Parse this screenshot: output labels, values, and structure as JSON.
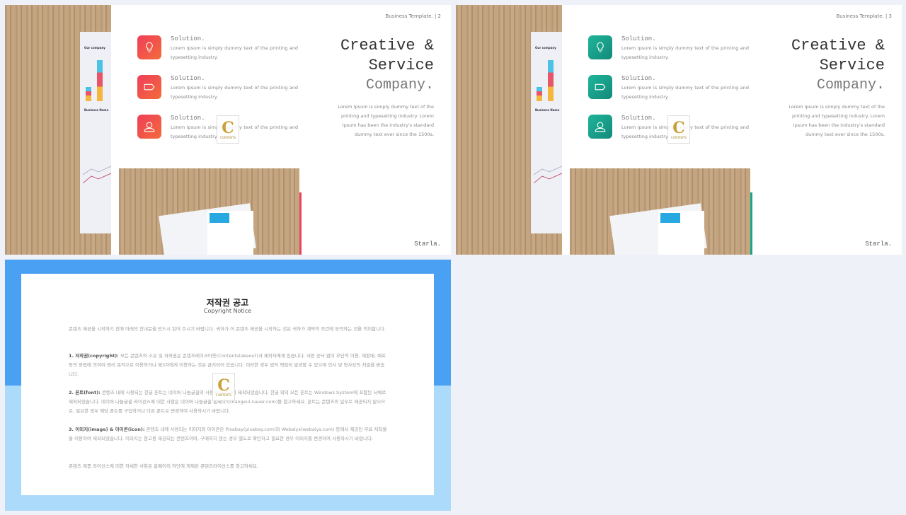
{
  "slides": [
    {
      "header": "Business Template.  |  2",
      "accent": "#f05a47",
      "items": [
        {
          "icon": "lightbulb-icon",
          "title": "Solution.",
          "text": "Lorem Ipsum is simply dummy text of the printing and typesetting industry."
        },
        {
          "icon": "tag-icon",
          "title": "Solution.",
          "text": "Lorem Ipsum is simply dummy text of the printing and typesetting industry."
        },
        {
          "icon": "user-icon",
          "title": "Solution.",
          "text": "Lorem Ipsum is simply dummy text of the printing and typesetting industry."
        }
      ],
      "title1": "Creative &",
      "title2": "Service",
      "title3": "Company.",
      "description": "Lorem Ipsum is simply dummy text of the printing and typesetting industry. Lorem Ipsum has been the industry's standard dummy text ever since the 1500s,",
      "signature": "Starla.",
      "paper_title1": "Our company",
      "paper_title2": "Business Name"
    },
    {
      "header": "Business Template.  |  3",
      "accent": "#1fa58c",
      "items": [
        {
          "icon": "lightbulb-icon",
          "title": "Solution.",
          "text": "Lorem Ipsum is simply dummy text of the printing and typesetting industry."
        },
        {
          "icon": "tag-icon",
          "title": "Solution.",
          "text": "Lorem Ipsum is simply dummy text of the printing and typesetting industry."
        },
        {
          "icon": "user-icon",
          "title": "Solution.",
          "text": "Lorem Ipsum is simply dummy text of the printing and typesetting industry."
        }
      ],
      "title1": "Creative &",
      "title2": "Service",
      "title3": "Company.",
      "description": "Lorem Ipsum is simply dummy text of the printing and typesetting industry. Lorem Ipsum has been the industry's standard dummy text ever since the 1500s,",
      "signature": "Starla.",
      "paper_title1": "Our company",
      "paper_title2": "Business Name"
    }
  ],
  "watermark": {
    "letter": "C",
    "text": "CONTENTS"
  },
  "copyright": {
    "title": "저작권 공고",
    "subtitle": "Copyright Notice",
    "intro": "콘텐츠 제공을 시작하기 전에 아래의 안내문을 반드시 읽어 주시기 바랍니다. 귀하가 이 콘텐츠 제공을 시작하는 것은 귀하가 계약의 조건에 동의하는 것을 의미합니다.",
    "p1_label": "1. 저작권(copyright):",
    "p1": " 모든 콘텐츠의 소유 및 저작권은 콘텐츠테이크아웃(Contentstakeout)과 제작자에게 있습니다. 사전 승낙 없이 무단적 이용, 재판매, 배포 등의 방법에 의하여 영리 목적으로 이용하거나 제3자에게 이용하는 것은 금지되어 있습니다. 이러한 경우 법적 책임이 발생할 수 있으며 민사 및 형사상의 처벌을 받습니다.",
    "p2_label": "2. 폰트(font):",
    "p2": " 콘텐츠 내에 사용되는 한글 폰트는 네이버 나눔글꼴의 사용을 권장하여 제작되었습니다. 한글 외의 모든 폰트는 Windows System에 포함된 서체로 제작되었습니다. 네이버 나눔글꼴 라이선스에 대한 사항은 네이버 나눔글꼴 홈페이지(hangeul.naver.com)를 참고하세요. 폰트는 콘텐츠의 일부로 제공되지 않으므로, 필요한 경우 해당 폰트를 구입하거나 다른 폰트로 변경하여 사용하시기 바랍니다.",
    "p3_label": "3. 이미지(image) & 아이콘(icon):",
    "p3": " 콘텐츠 내에 사용되는 이미지와 아이콘은 Pixabay(pixabay.com)와 Webalys(webalys.com) 등에서 제공된 무료 저작물을 이용하여 제작되었습니다. 이미지는 참고용 제공되는 콘텐츠이며, 구매하지 않는 경우 별도로 확인하고 필요한 경우 이미지를 변경하여 사용하시기 바랍니다.",
    "outro": "콘텐츠 제품 라이선스에 대한 자세한 사항은 홈페이지 하단에 게재된 콘텐츠라이선스를 참고하세요."
  }
}
